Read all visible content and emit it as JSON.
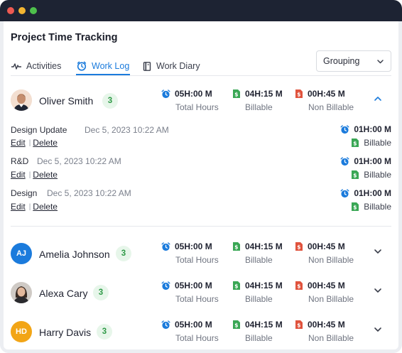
{
  "window": {
    "colors": {
      "close": "#ee5a52",
      "minimize": "#f3b531",
      "maximize": "#4ec04c",
      "titlebar": "#1d2333"
    }
  },
  "page": {
    "title": "Project Time Tracking"
  },
  "tabs": [
    {
      "label": "Activities",
      "icon": "activity-pulse-icon",
      "active": false
    },
    {
      "label": "Work Log",
      "icon": "clock-icon",
      "active": true
    },
    {
      "label": "Work Diary",
      "icon": "notebook-icon",
      "active": false
    }
  ],
  "grouping": {
    "label": "Grouping",
    "icon": "chevron-down-icon"
  },
  "colors": {
    "accent": "#1b7bdc",
    "billable": "#3aa755",
    "non_billable": "#e0533d",
    "count_bg": "#e7f6ea"
  },
  "metric_labels": {
    "total": "Total Hours",
    "billable": "Billable",
    "non_billable": "Non Billable"
  },
  "users": [
    {
      "name": "Oliver Smith",
      "count": "3",
      "avatar": "photo",
      "initials": "",
      "total": "05H:00 M",
      "billable": "04H:15 M",
      "non_billable": "00H:45 M",
      "expanded": true,
      "entries": [
        {
          "name": "Design Update",
          "date": "Dec 5, 2023 10:22 AM",
          "time": "01H:00 M",
          "billing": "Billable",
          "edit": "Edit",
          "delete": "Delete"
        },
        {
          "name": "R&D",
          "date": "Dec 5, 2023 10:22 AM",
          "time": "01H:00 M",
          "billing": "Billable",
          "edit": "Edit",
          "delete": "Delete"
        },
        {
          "name": "Design",
          "date": "Dec 5, 2023 10:22 AM",
          "time": "01H:00 M",
          "billing": "Billable",
          "edit": "Edit",
          "delete": "Delete"
        }
      ]
    },
    {
      "name": "Amelia Johnson",
      "count": "3",
      "avatar": "initials",
      "initials": "AJ",
      "avatar_color": "#1b7bdc",
      "total": "05H:00 M",
      "billable": "04H:15 M",
      "non_billable": "00H:45 M",
      "expanded": false
    },
    {
      "name": "Alexa Cary",
      "count": "3",
      "avatar": "photo",
      "initials": "",
      "total": "05H:00 M",
      "billable": "04H:15 M",
      "non_billable": "00H:45 M",
      "expanded": false
    },
    {
      "name": "Harry Davis",
      "count": "3",
      "avatar": "initials",
      "initials": "HD",
      "avatar_color": "#f2a516",
      "total": "05H:00 M",
      "billable": "04H:15 M",
      "non_billable": "00H:45 M",
      "expanded": false
    }
  ]
}
